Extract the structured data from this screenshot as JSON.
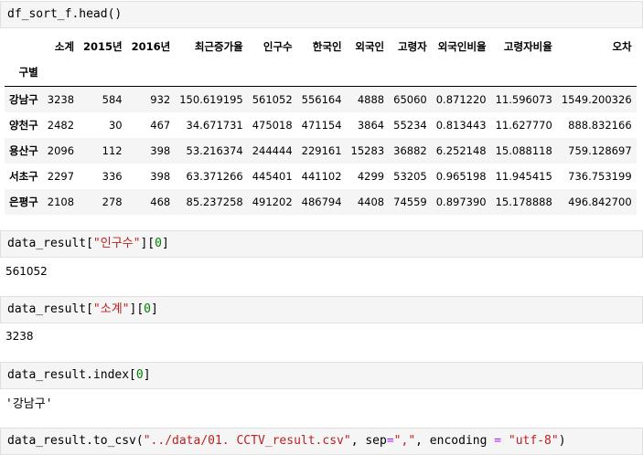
{
  "cell1": {
    "code": "df_sort_f.head()"
  },
  "table": {
    "columns": [
      "소계",
      "2015년",
      "2016년",
      "최근증가율",
      "인구수",
      "한국인",
      "외국인",
      "고령자",
      "외국인비율",
      "고령자비율",
      "오차"
    ],
    "index_name": "구별",
    "rows": [
      {
        "index": "강남구",
        "values": [
          "3238",
          "584",
          "932",
          "150.619195",
          "561052",
          "556164",
          "4888",
          "65060",
          "0.871220",
          "11.596073",
          "1549.200326"
        ]
      },
      {
        "index": "양천구",
        "values": [
          "2482",
          "30",
          "467",
          "34.671731",
          "475018",
          "471154",
          "3864",
          "55234",
          "0.813443",
          "11.627770",
          "888.832166"
        ]
      },
      {
        "index": "용산구",
        "values": [
          "2096",
          "112",
          "398",
          "53.216374",
          "244444",
          "229161",
          "15283",
          "36882",
          "6.252148",
          "15.088118",
          "759.128697"
        ]
      },
      {
        "index": "서초구",
        "values": [
          "2297",
          "336",
          "398",
          "63.371266",
          "445401",
          "441102",
          "4299",
          "53205",
          "0.965198",
          "11.945415",
          "736.753199"
        ]
      },
      {
        "index": "은평구",
        "values": [
          "2108",
          "278",
          "468",
          "85.237258",
          "491202",
          "486794",
          "4408",
          "74559",
          "0.897390",
          "15.178888",
          "496.842700"
        ]
      }
    ]
  },
  "cell2": {
    "code_a": "data_result[",
    "code_str": "\"인구수\"",
    "code_b": "][",
    "code_num": "0",
    "code_c": "]",
    "output": "561052"
  },
  "cell3": {
    "code_a": "data_result[",
    "code_str": "\"소계\"",
    "code_b": "][",
    "code_num": "0",
    "code_c": "]",
    "output": "3238"
  },
  "cell4": {
    "code_a": "data_result.index[",
    "code_num": "0",
    "code_c": "]",
    "output": "'강남구'"
  },
  "cell5": {
    "code_a": "data_result.to_csv(",
    "code_str1": "\"../data/01. CCTV_result.csv\"",
    "code_b": ", sep",
    "code_op1": "=",
    "code_str2": "\",\"",
    "code_c": ", encoding ",
    "code_op2": "=",
    "code_d": " ",
    "code_str3": "\"utf-8\"",
    "code_e": ")"
  }
}
